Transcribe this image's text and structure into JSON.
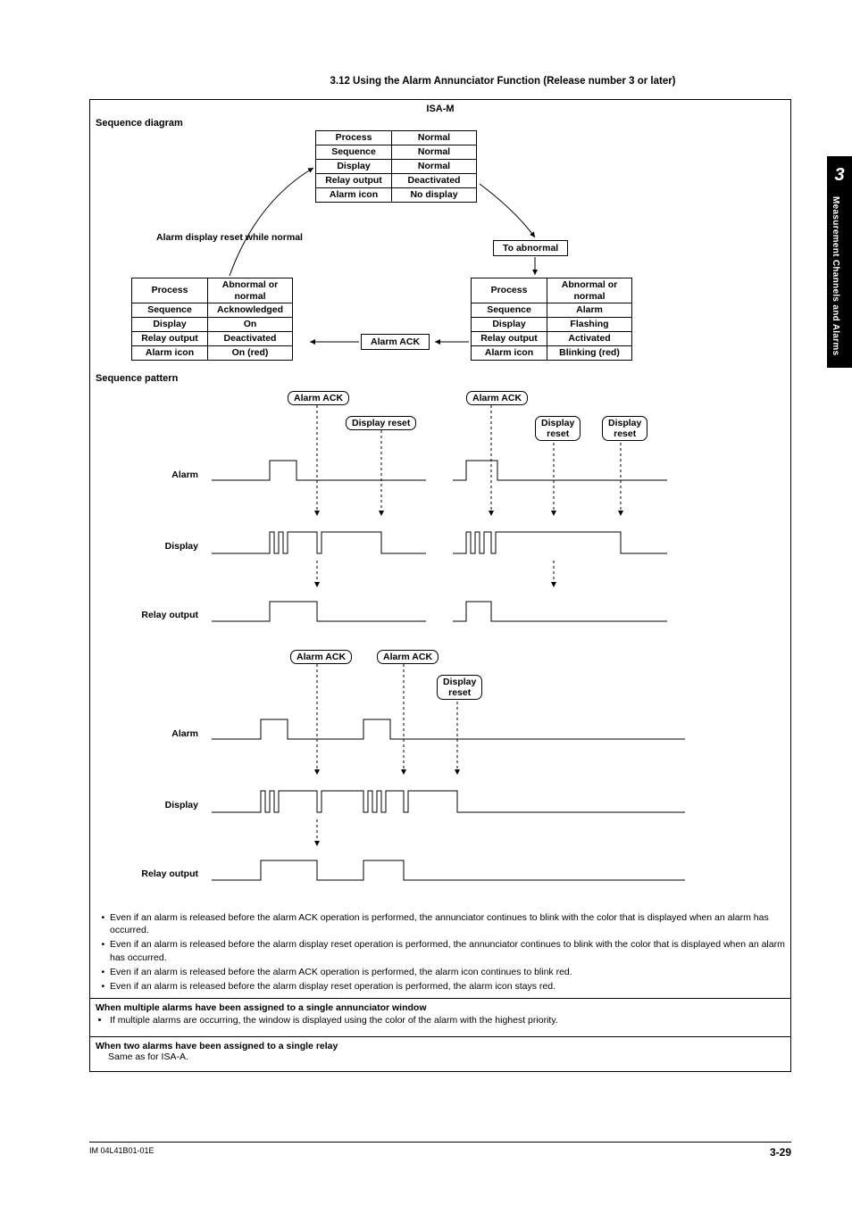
{
  "section_title": "3.12  Using the Alarm Annunciator Function (Release number 3 or later)",
  "isa_header": "ISA-M",
  "seq_diagram_header": "Sequence diagram",
  "seq_pattern_header": "Sequence pattern",
  "top_state": {
    "r1l": "Process",
    "r1v": "Normal",
    "r2l": "Sequence",
    "r2v": "Normal",
    "r3l": "Display",
    "r3v": "Normal",
    "r4l": "Relay output",
    "r4v": "Deactivated",
    "r5l": "Alarm icon",
    "r5v": "No display"
  },
  "left_state": {
    "r1l": "Process",
    "r1v": "Abnormal or normal",
    "r2l": "Sequence",
    "r2v": "Acknowledged",
    "r3l": "Display",
    "r3v": "On",
    "r4l": "Relay output",
    "r4v": "Deactivated",
    "r5l": "Alarm icon",
    "r5v": "On (red)"
  },
  "right_state": {
    "r1l": "Process",
    "r1v": "Abnormal or normal",
    "r2l": "Sequence",
    "r2v": "Alarm",
    "r3l": "Display",
    "r3v": "Flashing",
    "r4l": "Relay output",
    "r4v": "Activated",
    "r5l": "Alarm icon",
    "r5v": "Blinking (red)"
  },
  "labels": {
    "reset_while_normal": "Alarm display reset while normal",
    "to_abnormal": "To abnormal",
    "alarm_ack": "Alarm ACK",
    "display_reset": "Display reset",
    "display_reset_2line": "Display\nreset",
    "alarm": "Alarm",
    "display": "Display",
    "relay_output": "Relay output"
  },
  "notes_header": "",
  "notes": [
    "Even if an alarm is released before the alarm ACK operation is performed, the annunciator continues to blink with the color that is displayed when an alarm has occurred.",
    "Even if an alarm is released before the alarm display reset operation is performed, the annunciator continues to blink with the color that is displayed when an alarm has occurred.",
    "Even if an alarm is released before the alarm ACK operation is performed, the alarm icon continues to blink red.",
    "Even if an alarm is released before the alarm display reset operation is performed, the alarm icon stays red."
  ],
  "multi_header": "When multiple alarms have been assigned to a single annunciator window",
  "multi_body": "If multiple alarms are occurring, the window is displayed using the color of the alarm with the highest priority.",
  "two_header": "When two alarms have been assigned to a single relay",
  "two_body": "Same as for ISA-A.",
  "footer_left": "IM 04L41B01-01E",
  "footer_right": "3-29",
  "tab_num": "3",
  "tab_text": "Measurement Channels and Alarms"
}
